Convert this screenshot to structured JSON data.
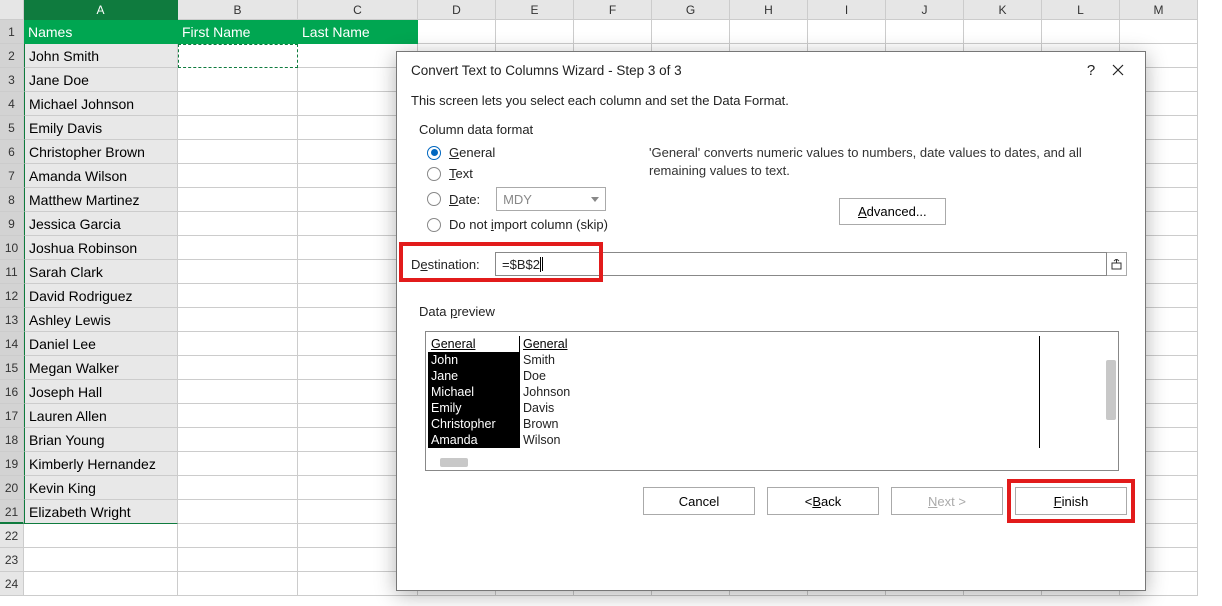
{
  "columns": [
    "A",
    "B",
    "C",
    "D",
    "E",
    "F",
    "G",
    "H",
    "I",
    "J",
    "K",
    "L",
    "M"
  ],
  "headerRow": {
    "A": "Names",
    "B": "First Name",
    "C": "Last Name"
  },
  "dataRows": [
    "John Smith",
    "Jane Doe",
    "Michael Johnson",
    "Emily Davis",
    "Christopher Brown",
    "Amanda Wilson",
    "Matthew Martinez",
    "Jessica Garcia",
    "Joshua Robinson",
    "Sarah Clark",
    "David Rodriguez",
    "Ashley Lewis",
    "Daniel Lee",
    "Megan Walker",
    "Joseph Hall",
    "Lauren Allen",
    "Brian Young",
    "Kimberly Hernandez",
    "Kevin King",
    "Elizabeth Wright"
  ],
  "dialog": {
    "title": "Convert Text to Columns Wizard - Step 3 of 3",
    "desc": "This screen lets you select each column and set the Data Format.",
    "groupLabel": "Column data format",
    "radios": {
      "general": "General",
      "text": "Text",
      "date": "Date:",
      "skip": "Do not import column (skip)"
    },
    "dateFormat": "MDY",
    "generalDesc": "'General' converts numeric values to numbers, date values to dates, and all remaining values to text.",
    "advanced": "Advanced...",
    "destLabel": "Destination:",
    "destValue": "=$B$2",
    "previewLabel": "Data preview",
    "previewHeaders": [
      "General",
      "General"
    ],
    "previewRows": [
      [
        "John",
        "Smith"
      ],
      [
        "Jane",
        "Doe"
      ],
      [
        "Michael",
        "Johnson"
      ],
      [
        "Emily",
        "Davis"
      ],
      [
        "Christopher",
        "Brown"
      ],
      [
        "Amanda",
        "Wilson"
      ]
    ],
    "buttons": {
      "cancel": "Cancel",
      "back": "< Back",
      "next": "Next >",
      "finish": "Finish"
    }
  }
}
